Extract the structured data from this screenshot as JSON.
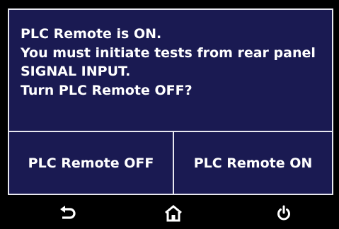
{
  "dialog": {
    "message_lines": [
      "PLC Remote is ON.",
      "You must initiate tests from rear panel",
      "SIGNAL INPUT.",
      "Turn PLC Remote OFF?"
    ],
    "button_off_label": "PLC Remote OFF",
    "button_on_label": "PLC Remote ON"
  },
  "nav": {
    "back_icon": "back-arrow-icon",
    "home_icon": "home-icon",
    "power_icon": "power-icon"
  },
  "colors": {
    "dialog_background": "#1a1a52",
    "border": "#e8e8f0",
    "text": "#ffffff",
    "background": "#000000"
  }
}
